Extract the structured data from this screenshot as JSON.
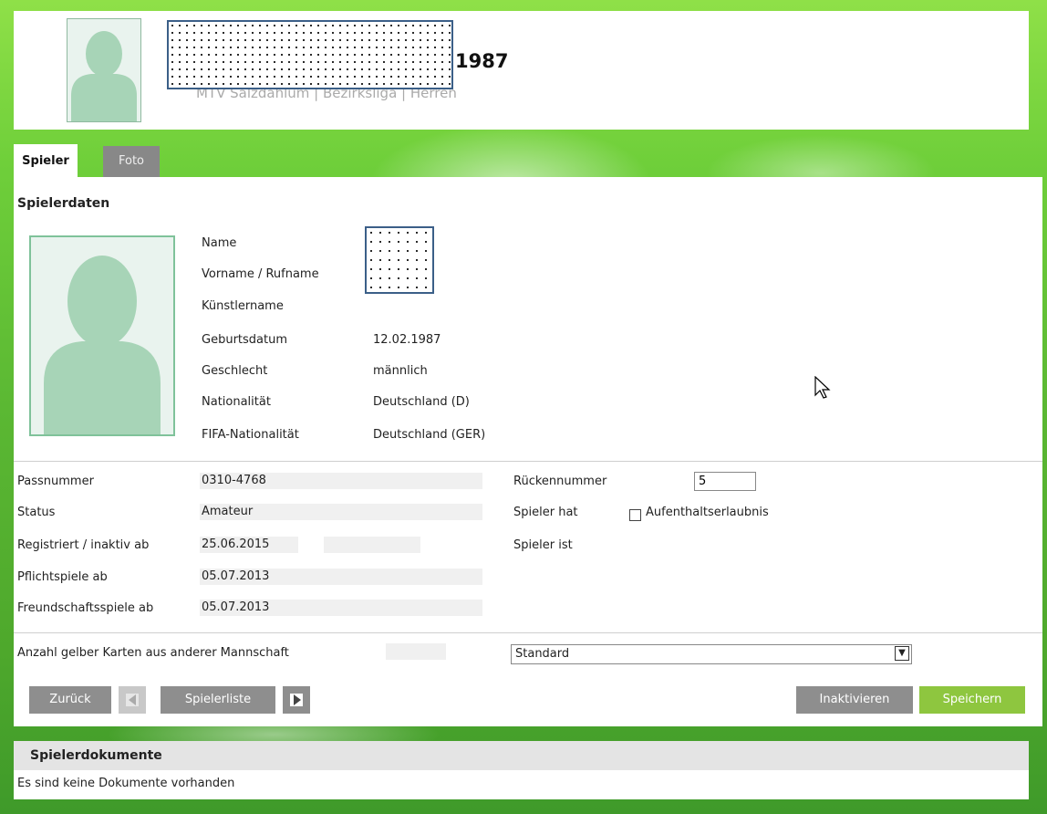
{
  "header": {
    "name_suffix": "1987",
    "subtitle": "MTV Salzdahlum | Bezirksliga | Herren"
  },
  "tabs": [
    {
      "label": "Spieler",
      "active": true
    },
    {
      "label": "Foto",
      "active": false
    }
  ],
  "section_title": "Spielerdaten",
  "personal": {
    "name_label": "Name",
    "vorname_label": "Vorname / Rufname",
    "kuenstlername_label": "Künstlername",
    "geburtsdatum_label": "Geburtsdatum",
    "geburtsdatum": "12.02.1987",
    "geschlecht_label": "Geschlecht",
    "geschlecht": "männlich",
    "nationalitaet_label": "Nationalität",
    "nationalitaet": "Deutschland (D)",
    "fifa_label": "FIFA-Nationalität",
    "fifa": "Deutschland (GER)"
  },
  "registration": {
    "passnummer_label": "Passnummer",
    "passnummer": "0310-4768",
    "status_label": "Status",
    "status": "Amateur",
    "registriert_label": "Registriert / inaktiv ab",
    "registriert": "25.06.2015",
    "inaktiv": "",
    "pflicht_label": "Pflichtspiele ab",
    "pflicht": "05.07.2013",
    "freund_label": "Freundschaftsspiele ab",
    "freund": "05.07.2013",
    "rueckennummer_label": "Rückennummer",
    "rueckennummer": "5",
    "spieler_hat_label": "Spieler hat",
    "aufenthalt_label": "Aufenthaltserlaubnis",
    "spieler_ist_label": "Spieler ist"
  },
  "cards": {
    "label": "Anzahl gelber Karten aus anderer Mannschaft",
    "value": "",
    "select_value": "Standard"
  },
  "buttons": {
    "zurueck": "Zurück",
    "spielerliste": "Spielerliste",
    "inaktivieren": "Inaktivieren",
    "speichern": "Speichern"
  },
  "documents": {
    "title": "Spielerdokumente",
    "empty": "Es sind keine Dokumente vorhanden"
  },
  "colors": {
    "accent_green": "#8ec63f",
    "button_grey": "#8e8e8e",
    "avatar_border": "#7fc29a"
  }
}
